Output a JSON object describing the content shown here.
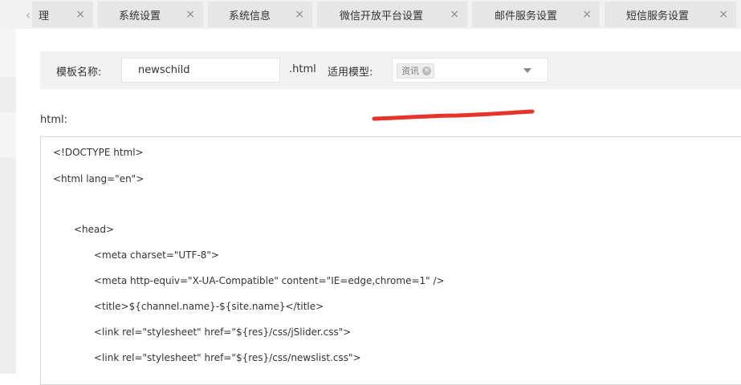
{
  "tabs": [
    {
      "label": "理",
      "close": "×"
    },
    {
      "label": "系统设置",
      "close": "×"
    },
    {
      "label": "系统信息",
      "close": "×"
    },
    {
      "label": "微信开放平台设置",
      "close": "×"
    },
    {
      "label": "邮件服务设置",
      "close": "×"
    },
    {
      "label": "短信服务设置",
      "close": "×"
    }
  ],
  "tab_scroll_left": "‹",
  "form": {
    "template_name_label": "模板名称:",
    "template_name_value": "newschild",
    "suffix": ".html",
    "model_label": "适用模型:",
    "model_selected": "资讯",
    "chip_remove": "×"
  },
  "editor": {
    "label": "html:",
    "lines": [
      "<!DOCTYPE html>",
      "<html lang=\"en\">",
      "",
      "<head>",
      "<meta charset=\"UTF-8\">",
      "<meta http-equiv=\"X-UA-Compatible\" content=\"IE=edge,chrome=1\" />",
      "<title>${channel.name}-${site.name}</title>",
      "<link rel=\"stylesheet\" href=\"${res}/css/jSlider.css\">",
      "<link rel=\"stylesheet\" href=\"${res}/css/newslist.css\">"
    ]
  },
  "colors": {
    "annotation": "#e8332a",
    "tab_bg": "#e6e6e6",
    "toolbar_bg": "#f2f2f2"
  }
}
